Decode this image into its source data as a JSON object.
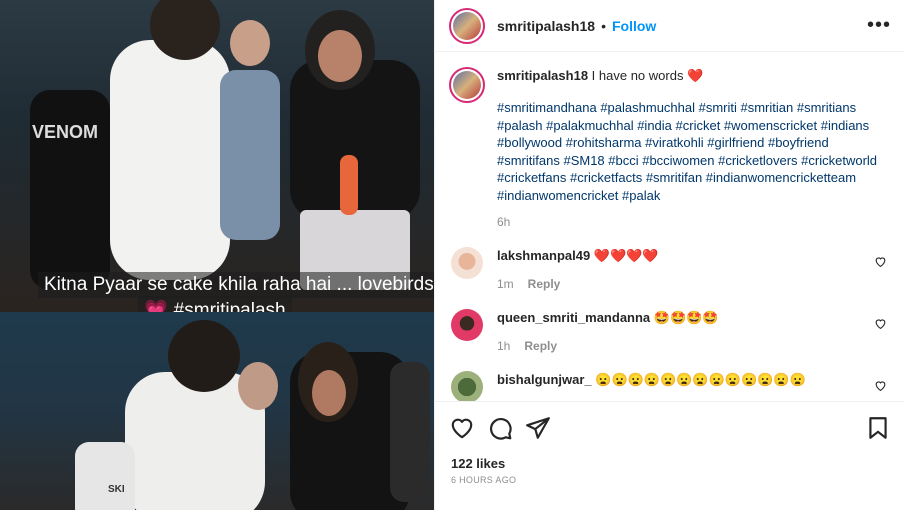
{
  "media": {
    "caption_line1": "Kitna Pyaar se cake khila raha hai ... lovebirds",
    "caption_line2_emoji": "💗",
    "caption_line2_text": "#smritipalash",
    "top_shirt_text": "VENOM",
    "bottom_shirt_text": "SKI"
  },
  "header": {
    "username": "smritipalash18",
    "separator": "•",
    "follow_label": "Follow",
    "more_label": "•••"
  },
  "caption": {
    "username": "smritipalash18",
    "text": "I have no words",
    "emoji": "❤️",
    "hashtags": "#smritimandhana #palashmuchhal #smriti #smritian #smritians #palash  #palakmuchhal #india #cricket #womenscricket #indians  #bollywood #rohitsharma  #viratkohli #girlfriend #boyfriend #smritifans #SM18 #bcci #bcciwomen #cricketlovers #cricketworld #cricketfans #cricketfacts #smritifan #indianwomencricketteam #indianwomencricket #palak",
    "time": "6h"
  },
  "comments": [
    {
      "username": "lakshmanpal49",
      "text": "❤️❤️❤️❤️",
      "time": "1m",
      "reply_label": "Reply"
    },
    {
      "username": "queen_smriti_mandanna",
      "text": "🤩🤩🤩🤩",
      "time": "1h",
      "reply_label": "Reply"
    },
    {
      "username": "bishalgunjwar_",
      "text": "😦😦😦😦😦😦😦😦😦😦😦😦😦",
      "time": "",
      "reply_label": ""
    }
  ],
  "likes": "122 likes",
  "posted_ago": "6 HOURS AGO",
  "icons": {
    "like": "heart-icon",
    "comment": "comment-icon",
    "share": "share-icon",
    "save": "bookmark-icon"
  },
  "colors": {
    "accent": "#0095f6",
    "hashtag": "#00376b",
    "muted": "#8e8e8e"
  }
}
